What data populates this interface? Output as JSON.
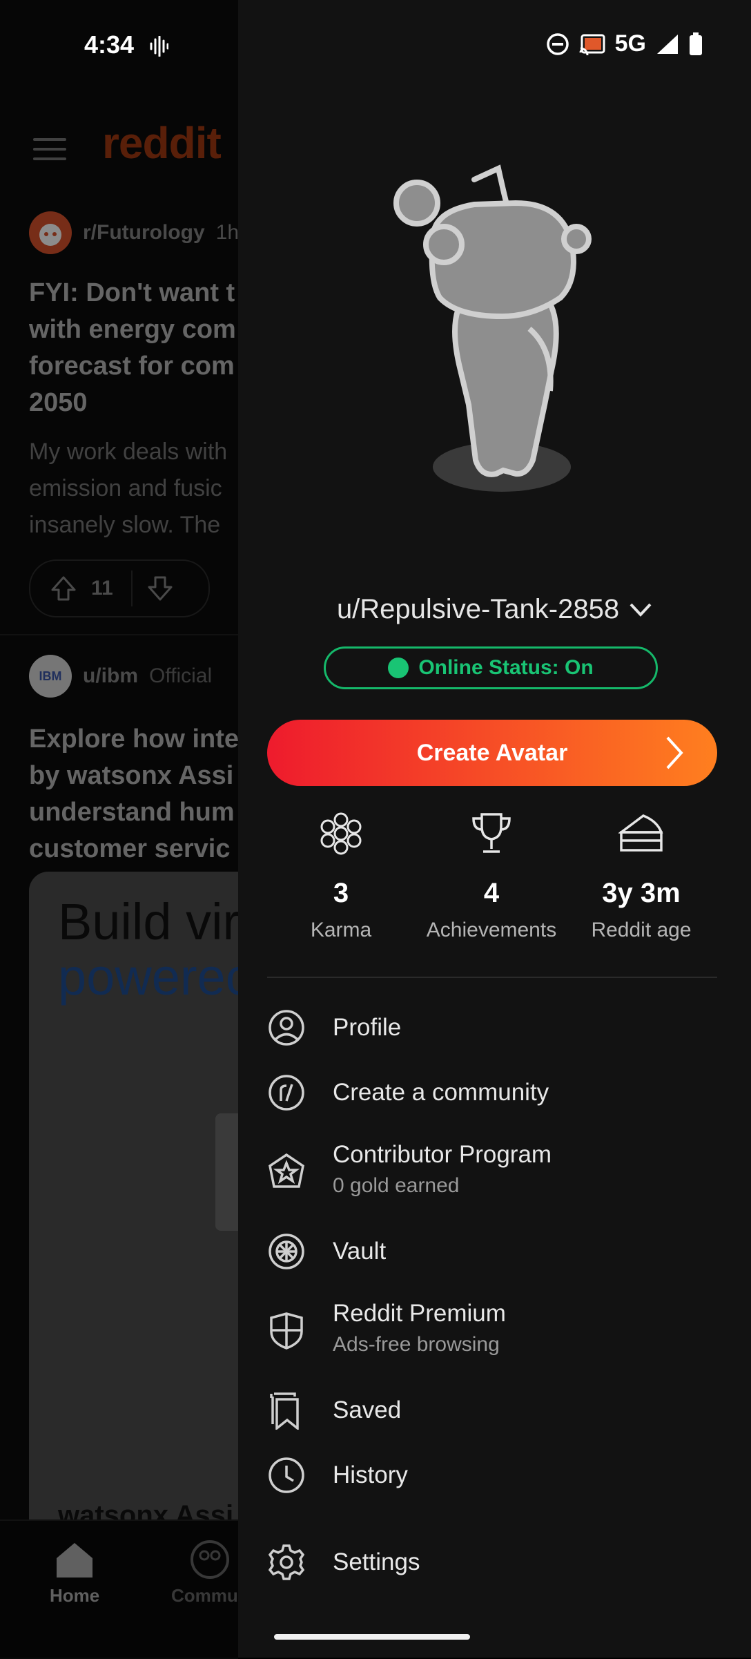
{
  "status_bar": {
    "time": "4:34",
    "network": "5G"
  },
  "feed": {
    "brand": "reddit",
    "posts": [
      {
        "subreddit": "r/Futurology",
        "age": "1h",
        "title": "FYI: Don't want t\nwith energy com\nforecast for com\n2050",
        "body": "My work deals with\nemission and fusic\ninsanely slow. The",
        "votes": "11"
      },
      {
        "author": "u/ibm",
        "badge": "Official",
        "avatar_text": "IBM",
        "title": "Explore how inte\nby watsonx Assi\nunderstand hum\ncustomer servic",
        "ad_line1": "Build vir",
        "ad_line2": "powerec",
        "ad_footer": "watsonx Assi"
      }
    ],
    "nav": {
      "home": "Home",
      "communities": "Commun"
    }
  },
  "drawer": {
    "username": "u/Repulsive-Tank-2858",
    "online_status": "Online Status: On",
    "create_avatar": "Create Avatar",
    "stats": [
      {
        "icon": "karma-icon",
        "value": "3",
        "label": "Karma"
      },
      {
        "icon": "trophy-icon",
        "value": "4",
        "label": "Achievements"
      },
      {
        "icon": "cake-icon",
        "value": "3y 3m",
        "label": "Reddit age"
      }
    ],
    "menu": [
      {
        "icon": "profile-icon",
        "label": "Profile"
      },
      {
        "icon": "community-icon",
        "label": "Create a community"
      },
      {
        "icon": "contributor-icon",
        "label": "Contributor Program",
        "sub": "0 gold earned"
      },
      {
        "icon": "vault-icon",
        "label": "Vault"
      },
      {
        "icon": "premium-icon",
        "label": "Reddit Premium",
        "sub": "Ads-free browsing"
      },
      {
        "icon": "saved-icon",
        "label": "Saved"
      },
      {
        "icon": "history-icon",
        "label": "History"
      },
      {
        "icon": "settings-icon",
        "label": "Settings"
      }
    ]
  },
  "colors": {
    "accent_orange": "#ff4500",
    "online_green": "#19c474",
    "drawer_bg": "#121212"
  }
}
